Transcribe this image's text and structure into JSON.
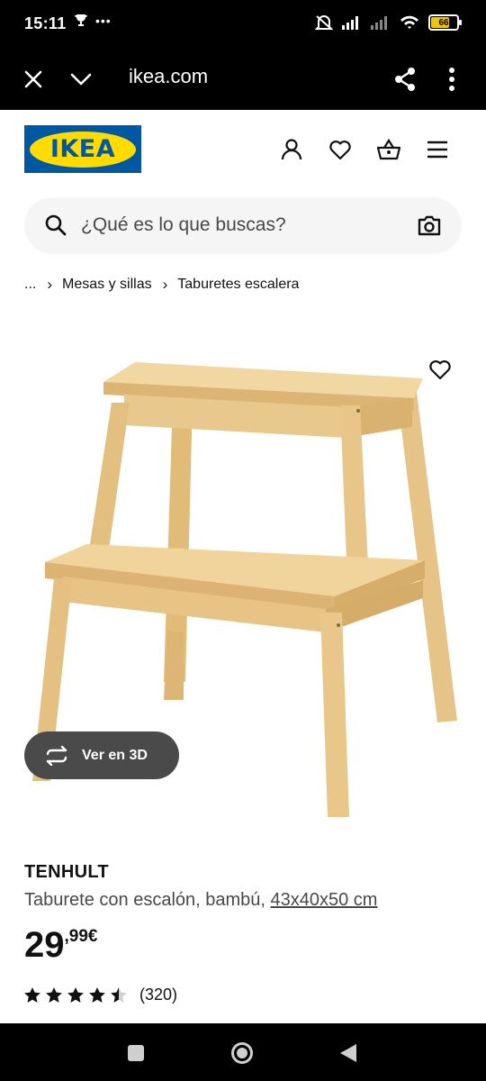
{
  "status_bar": {
    "time": "15:11",
    "battery": "66"
  },
  "browser": {
    "url": "ikea.com"
  },
  "header": {
    "logo_text": "IKEA"
  },
  "search": {
    "placeholder": "¿Qué es lo que buscas?"
  },
  "breadcrumb": {
    "ellipsis": "...",
    "items": [
      "Mesas y sillas",
      "Taburetes escalera"
    ],
    "separator": "›"
  },
  "product": {
    "view_3d_label": "Ver en 3D",
    "name": "TENHULT",
    "description": "Taburete con escalón, bambú,",
    "dimensions": "43x40x50 cm",
    "price_integer": "29",
    "price_decimal": ",99€",
    "rating_value": 4.5,
    "rating_count": "(320)"
  },
  "colors": {
    "ikea_blue": "#0058a3",
    "ikea_yellow": "#ffdb00",
    "bamboo": "#e8c88a"
  },
  "icons": [
    "close-icon",
    "chevron-down-icon",
    "share-icon",
    "more-vert-icon",
    "user-icon",
    "heart-icon",
    "basket-icon",
    "menu-icon",
    "search-icon",
    "camera-icon",
    "rotate-3d-icon",
    "star-icon"
  ]
}
